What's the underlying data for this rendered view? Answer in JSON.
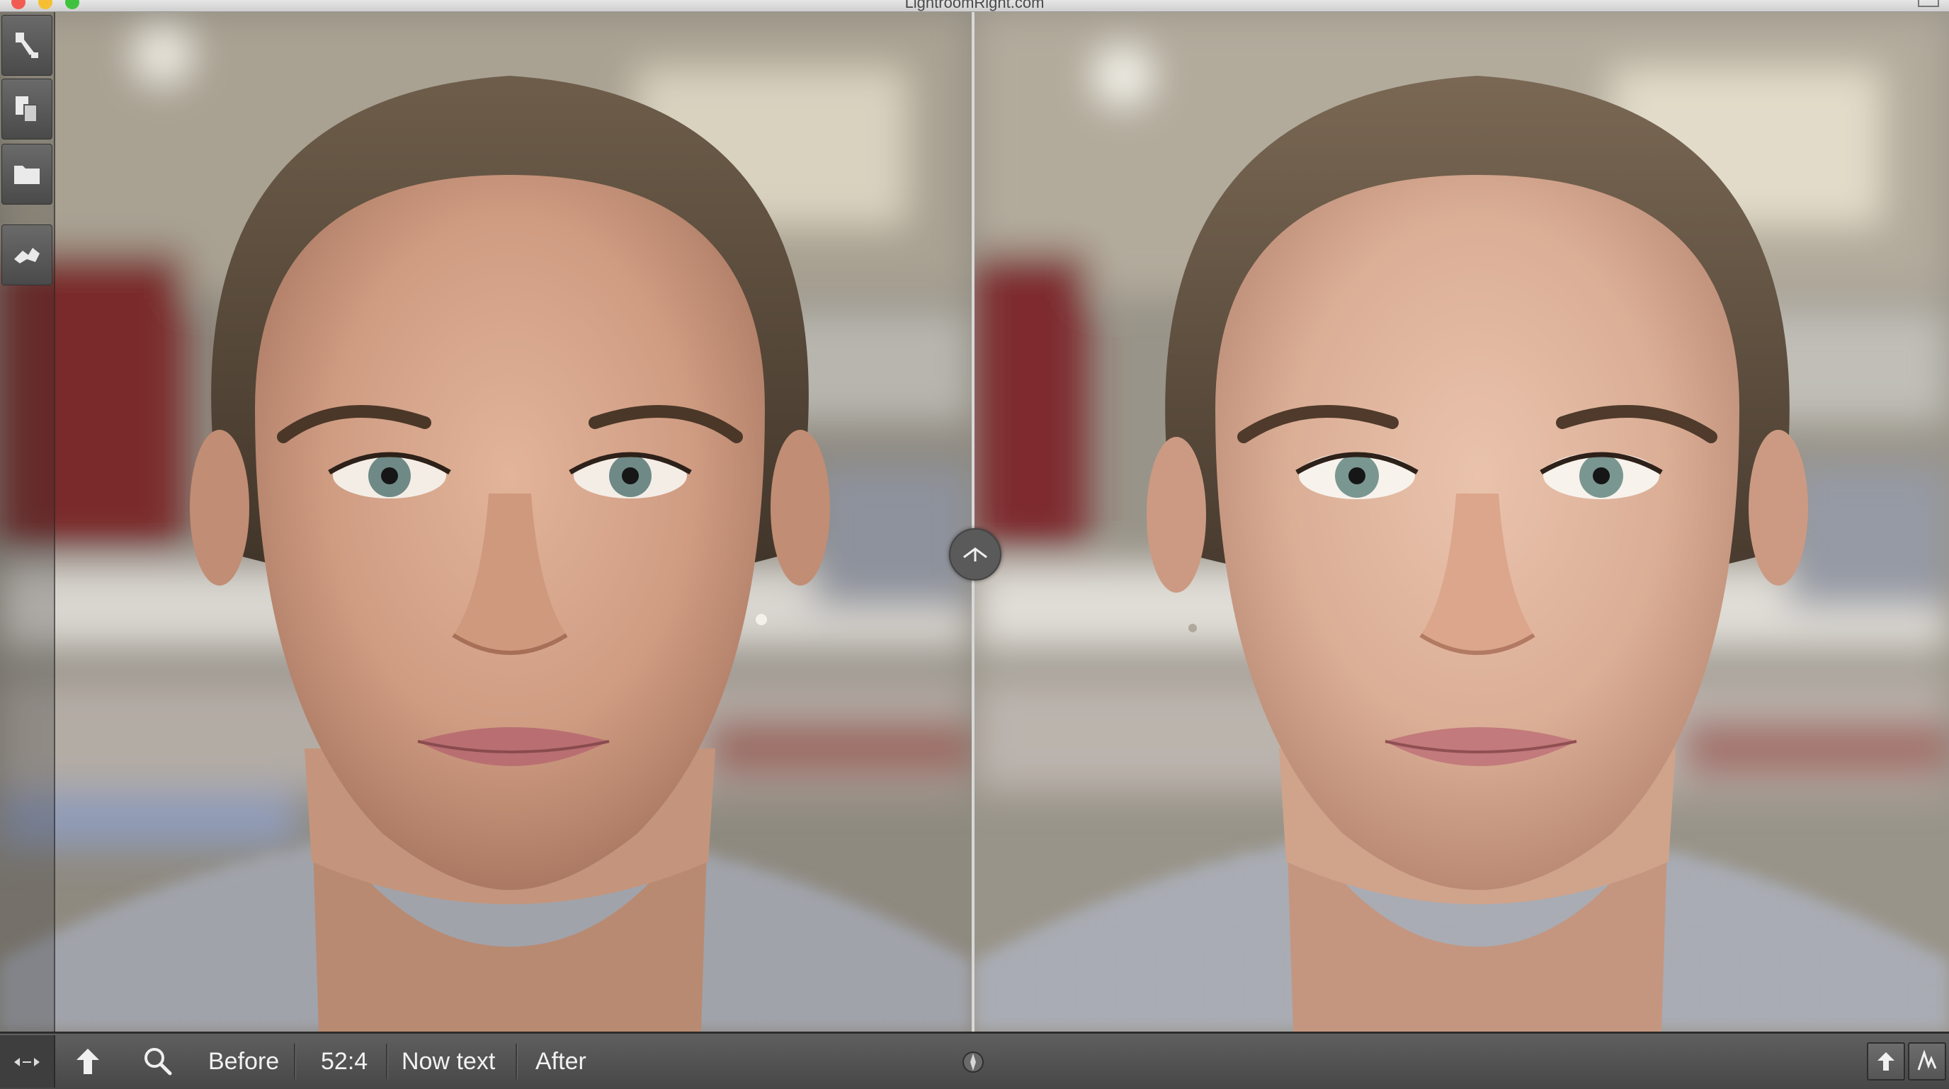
{
  "window": {
    "title": "LightroomRight.com"
  },
  "toolstrip": {
    "tools": [
      {
        "name": "crop-tool",
        "icon": "crop-icon"
      },
      {
        "name": "copy-tool",
        "icon": "copy-pages-icon"
      },
      {
        "name": "folder-tool",
        "icon": "folder-icon"
      },
      {
        "name": "transform-tool",
        "icon": "transform-icon"
      }
    ]
  },
  "viewer": {
    "mode": "before-after-split",
    "left_label": "Before",
    "right_label": "After"
  },
  "toolbar": {
    "before_label": "Before",
    "ratio_label": "52:4",
    "now_text_label": "Now text",
    "after_label": "After",
    "icons": [
      "expand-arrows-icon",
      "arrow-up-icon",
      "search-icon",
      "compass-icon",
      "upload-icon",
      "signature-icon"
    ]
  },
  "colors": {
    "toolbar_bg": "#4f4f4f",
    "toolbar_text": "#f2f2f2",
    "divider": "#d8d8d8",
    "close": "#f25b52",
    "minimize": "#f6be33",
    "zoom": "#3fc23e"
  }
}
